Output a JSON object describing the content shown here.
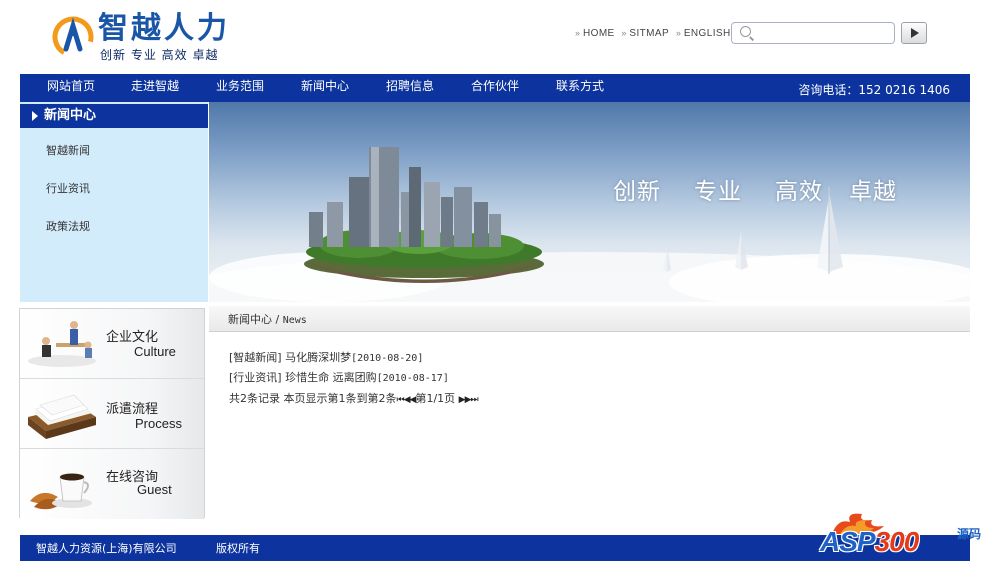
{
  "brand": {
    "name": "智越人力",
    "tagline": "创新  专业  高效  卓越",
    "colors": {
      "primary": "#0d349e",
      "logo_blue": "#1a56a8",
      "logo_orange": "#f39a1a",
      "subnav_bg": "#d3ecfb"
    }
  },
  "toplinks": [
    {
      "label": "HOME"
    },
    {
      "label": "SITMAP"
    },
    {
      "label": "ENGLISH"
    }
  ],
  "search": {
    "placeholder": "",
    "value": "",
    "icon": "search-icon",
    "button_icon": "play-arrow-icon"
  },
  "nav": {
    "items": [
      {
        "label": "网站首页"
      },
      {
        "label": "走进智越"
      },
      {
        "label": "业务范围"
      },
      {
        "label": "新闻中心"
      },
      {
        "label": "招聘信息"
      },
      {
        "label": "合作伙伴"
      },
      {
        "label": "联系方式"
      }
    ],
    "hotline": "咨询电话：152  0216  1406"
  },
  "subnav": {
    "title": "新闻中心",
    "items": [
      {
        "label": "智越新闻"
      },
      {
        "label": "行业资讯"
      },
      {
        "label": "政策法规"
      }
    ]
  },
  "banner": {
    "slogans": [
      "创新",
      "专业",
      "高效",
      "卓越"
    ]
  },
  "features": [
    {
      "cn": "企业文化",
      "en": "Culture",
      "icon": "meeting-icon"
    },
    {
      "cn": "派遣流程",
      "en": "Process",
      "icon": "documents-tray-icon"
    },
    {
      "cn": "在线咨询",
      "en": "Guest",
      "icon": "coffee-cup-icon"
    }
  ],
  "breadcrumb": {
    "section": "新闻中心",
    "separator": "/",
    "en": "News"
  },
  "news": [
    {
      "category": "[智越新闻]",
      "title": "马化腾深圳梦",
      "date": "[2010-08-20]"
    },
    {
      "category": "[行业资讯]",
      "title": "珍惜生命 远离团购",
      "date": "[2010-08-17]"
    }
  ],
  "pager": {
    "summary": "共2条记录 本页显示第1条到第2条",
    "page_info": "第1/1页",
    "first": "⏮",
    "prev": "◀◀",
    "next": "▶▶",
    "last": "⏭"
  },
  "footer": {
    "copyright": "智越人力资源(上海)有限公司",
    "rights": "版权所有"
  },
  "watermark": {
    "prefix": "ASP",
    "digits": "300",
    "cn": "源码"
  }
}
